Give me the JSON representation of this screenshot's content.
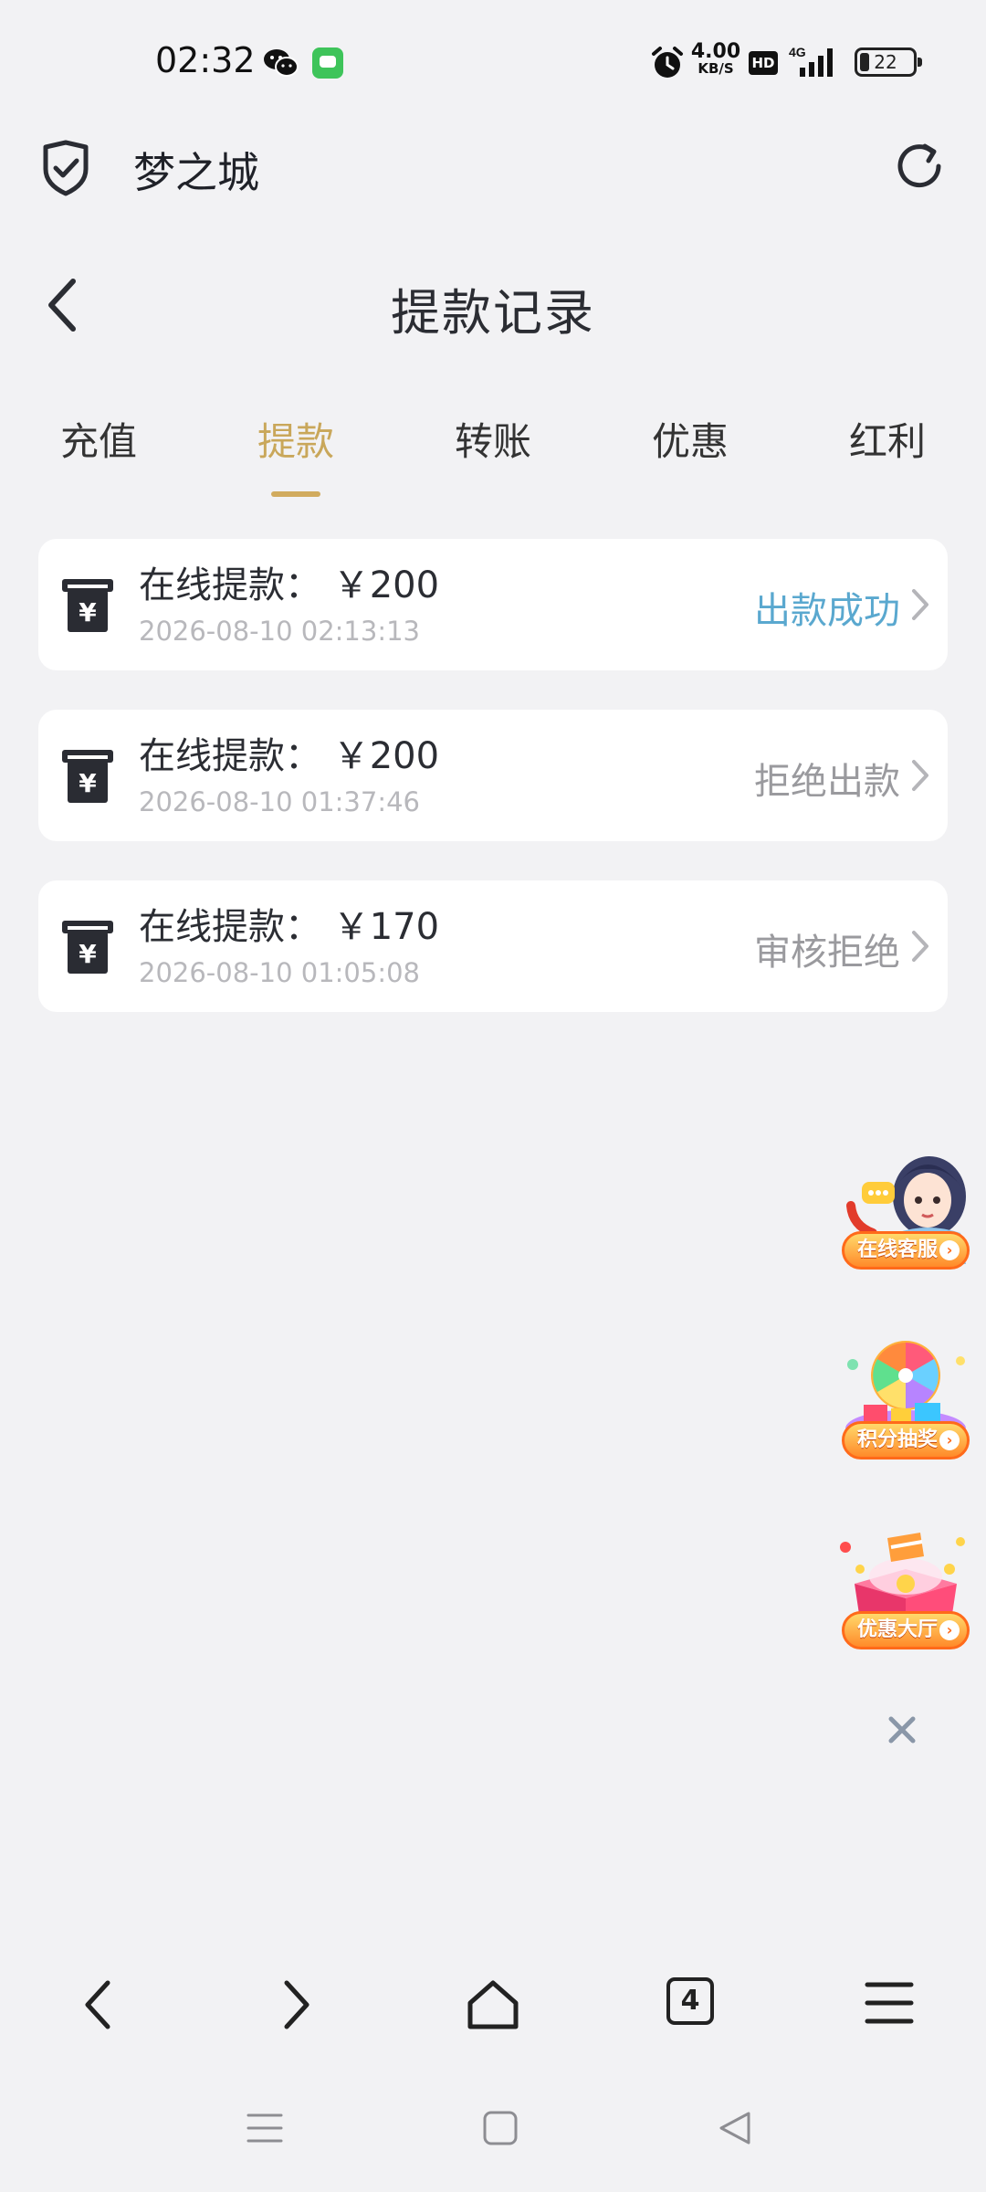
{
  "status_bar": {
    "time": "02:32",
    "net_speed_value": "4.00",
    "net_speed_unit": "KB/S",
    "hd_label": "HD",
    "network_type": "4G",
    "battery_level": "22"
  },
  "browser": {
    "site_title": "梦之城",
    "tab_count": "4"
  },
  "page": {
    "title": "提款记录"
  },
  "tabs": [
    {
      "label": "充值",
      "active": false
    },
    {
      "label": "提款",
      "active": true
    },
    {
      "label": "转账",
      "active": false
    },
    {
      "label": "优惠",
      "active": false
    },
    {
      "label": "红利",
      "active": false
    }
  ],
  "records": [
    {
      "title": "在线提款： ￥200",
      "time": "2026-08-10 02:13:13",
      "status": "出款成功"
    },
    {
      "title": "在线提款： ￥200",
      "time": "2026-08-10 01:37:46",
      "status": "拒绝出款"
    },
    {
      "title": "在线提款： ￥170",
      "time": "2026-08-10 01:05:08",
      "status": "审核拒绝"
    }
  ],
  "float_widgets": [
    {
      "label": "在线客服"
    },
    {
      "label": "积分抽奖"
    },
    {
      "label": "优惠大厅"
    }
  ],
  "colors": {
    "accent_gold": "#c9a75a",
    "success_blue": "#5aa8cf",
    "muted_status": "#9a9a9e",
    "background": "#f2f2f4"
  },
  "icons": {
    "site": "shield-check-icon",
    "refresh": "refresh-icon",
    "record": "atm-yuan-icon"
  }
}
